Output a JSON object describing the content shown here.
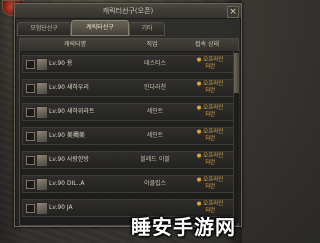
{
  "window": {
    "title": "캐릭터선구(오픈)",
    "close_glyph": "×"
  },
  "tabs": [
    {
      "label": "모험단선구",
      "active": false
    },
    {
      "label": "캐릭터선구",
      "active": true
    },
    {
      "label": "기타",
      "active": false
    }
  ],
  "table": {
    "headers": [
      "캐릭터명",
      "직업",
      "접속 상태"
    ],
    "rows": [
      {
        "level_name": "Lv.90 용",
        "job": "데스티스",
        "status_l1": "오프라인",
        "status_l2": "저런"
      },
      {
        "level_name": "Lv.90 새하우리",
        "job": "인다라천",
        "status_l1": "오프라인",
        "status_l2": "저런"
      },
      {
        "level_name": "Lv.90 새하위라트",
        "job": "세인트",
        "status_l1": "오프라인",
        "status_l2": "저런"
      },
      {
        "level_name": "Lv.90 美獨美",
        "job": "세인트",
        "status_l1": "오프라인",
        "status_l2": "저런"
      },
      {
        "level_name": "Lv.90 사랑한방",
        "job": "블레드 이블",
        "status_l1": "오프라인",
        "status_l2": "저런"
      },
      {
        "level_name": "Lv.90 DIL..A",
        "job": "이클립스",
        "status_l1": "오프라인",
        "status_l2": "저런"
      },
      {
        "level_name": "Lv.90 JA",
        "job": "",
        "status_l1": "오프라인",
        "status_l2": "저런"
      }
    ]
  },
  "watermark": "睡安手游网",
  "colors": {
    "status_offline": "#e0a545",
    "panel_border": "#6b6558"
  }
}
